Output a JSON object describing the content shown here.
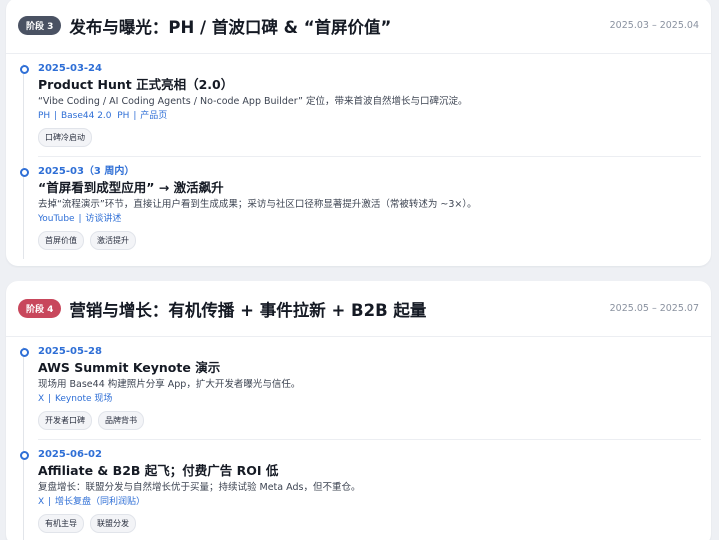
{
  "phase3": {
    "badge": "阶段 3",
    "title": "发布与曝光：PH / 首波口碑 & “首屏价值”",
    "range": "2025.03 – 2025.04",
    "events": [
      {
        "date": "2025-03-24",
        "title": "Product Hunt 正式亮相（2.0）",
        "desc": "“Vibe Coding / AI Coding Agents / No-code App Builder” 定位，带来首波自然增长与口碑沉淀。",
        "links": [
          "PH",
          "Base44 2.0",
          "PH",
          "产品页"
        ],
        "tags": [
          "口碑冷启动"
        ]
      },
      {
        "date": "2025-03（3 周内）",
        "title": "“首屏看到成型应用” → 激活飙升",
        "desc": "去掉“流程演示”环节，直接让用户看到生成成果；采访与社区口径称显著提升激活（常被转述为 ~3×）。",
        "links": [
          "YouTube",
          "访谈讲述"
        ],
        "tags": [
          "首屏价值",
          "激活提升"
        ]
      }
    ]
  },
  "phase4": {
    "badge": "阶段 4",
    "title": "营销与增长：有机传播 + 事件拉新 + B2B 起量",
    "range": "2025.05 – 2025.07",
    "events": [
      {
        "date": "2025-05-28",
        "title": "AWS Summit Keynote 演示",
        "desc": "现场用 Base44 构建照片分享 App，扩大开发者曝光与信任。",
        "links": [
          "X",
          "Keynote 现场"
        ],
        "tags": [
          "开发者口碑",
          "品牌背书"
        ]
      },
      {
        "date": "2025-06-02",
        "title": "Affiliate & B2B 起飞；付费广告 ROI 低",
        "desc": "复盘增长：联盟分发与自然增长优于买量；持续试验 Meta Ads，但不重仓。",
        "links": [
          "X",
          "增长复盘（同利润贴）"
        ],
        "tags": [
          "有机主导",
          "联盟分发"
        ]
      }
    ]
  }
}
